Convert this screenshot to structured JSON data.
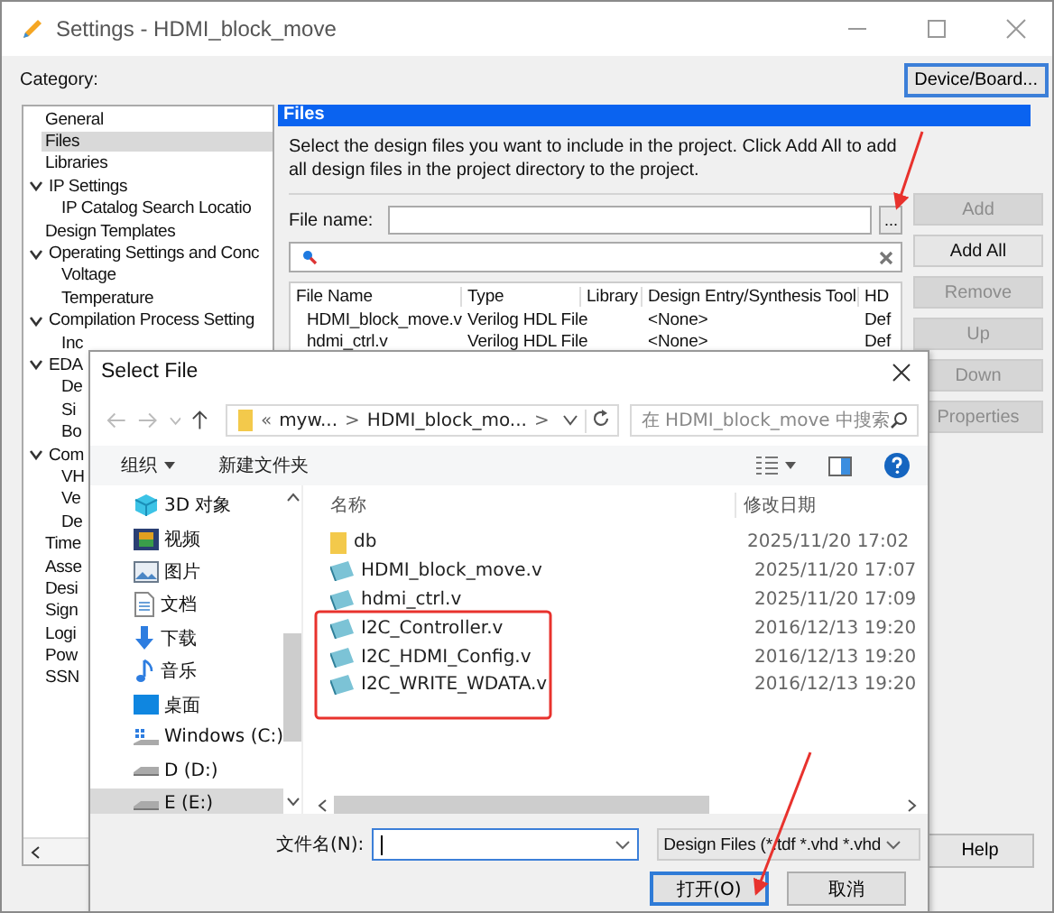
{
  "window": {
    "title": "Settings - HDMI_block_move"
  },
  "category_label": "Category:",
  "device_board_button": "Device/Board...",
  "category_tree": [
    {
      "label": "General",
      "selected": false
    },
    {
      "label": "Files",
      "selected": true
    },
    {
      "label": "Libraries",
      "selected": false
    },
    {
      "label": "IP Settings",
      "selected": false,
      "expanded": true,
      "children": [
        {
          "label": "IP Catalog Search Locatio",
          "selected": false
        }
      ]
    },
    {
      "label": "Design Templates",
      "selected": false
    },
    {
      "label": "Operating Settings and Conc",
      "selected": false,
      "expanded": true,
      "children": [
        {
          "label": "Voltage",
          "selected": false
        },
        {
          "label": "Temperature",
          "selected": false
        }
      ]
    },
    {
      "label": "Compilation Process Setting",
      "selected": false,
      "expanded": true,
      "children": [
        {
          "label": "Inc",
          "selected": false
        }
      ]
    },
    {
      "label": "EDA",
      "selected": false,
      "expanded": true,
      "children": [
        {
          "label": "De",
          "selected": false
        },
        {
          "label": "Si",
          "selected": false
        },
        {
          "label": "Bo",
          "selected": false
        }
      ]
    },
    {
      "label": "Com",
      "selected": false,
      "expanded": true,
      "children": [
        {
          "label": "VH",
          "selected": false
        },
        {
          "label": "Ve",
          "selected": false
        },
        {
          "label": "De",
          "selected": false
        }
      ]
    },
    {
      "label": "Time",
      "selected": false
    },
    {
      "label": "Asse",
      "selected": false
    },
    {
      "label": "Desi",
      "selected": false
    },
    {
      "label": "Sign",
      "selected": false
    },
    {
      "label": "Logi",
      "selected": false
    },
    {
      "label": "Pow",
      "selected": false
    },
    {
      "label": "SSN",
      "selected": false
    }
  ],
  "files_panel": {
    "title": "Files",
    "description": "Select the design files you want to include in the project. Click Add All to add all design files in the project directory to the project.",
    "file_name_label": "File name:",
    "browse_button": "...",
    "buttons": [
      {
        "label": "Add",
        "disabled": true
      },
      {
        "label": "Add All",
        "disabled": false
      },
      {
        "label": "Remove",
        "disabled": true
      },
      {
        "label": "Up",
        "disabled": true
      },
      {
        "label": "Down",
        "disabled": true
      },
      {
        "label": "Properties",
        "disabled": true
      }
    ],
    "table": {
      "columns": [
        "File Name",
        "Type",
        "Library",
        "Design Entry/Synthesis Tool",
        "HD"
      ],
      "rows": [
        {
          "file_name": "HDMI_block_move.v",
          "type": "Verilog HDL File",
          "design_entry": "<None>",
          "column_5": "Def"
        },
        {
          "file_name": "hdmi_ctrl.v",
          "type": "Verilog HDL File",
          "design_entry": "<None>",
          "column_5": "Def"
        }
      ]
    }
  },
  "help_button": "Help",
  "dialog": {
    "title": "Select File",
    "breadcrumb": [
      "«",
      "myw...",
      ">",
      "HDMI_block_mo...",
      ">"
    ],
    "search": {
      "placeholder": "在 HDMI_block_move 中搜索"
    },
    "toolbar": {
      "organize": "组织",
      "new_folder": "新建文件夹"
    },
    "nav_items": [
      {
        "label": "3D 对象",
        "kind": "cube",
        "selected": false
      },
      {
        "label": "视频",
        "kind": "video",
        "selected": false
      },
      {
        "label": "图片",
        "kind": "picture",
        "selected": false
      },
      {
        "label": "文档",
        "kind": "document",
        "selected": false
      },
      {
        "label": "下载",
        "kind": "download",
        "selected": false
      },
      {
        "label": "音乐",
        "kind": "music",
        "selected": false
      },
      {
        "label": "桌面",
        "kind": "desktop",
        "selected": false
      },
      {
        "label": "Windows (C:)",
        "kind": "system_drive",
        "selected": false
      },
      {
        "label": "D (D:)",
        "kind": "drive",
        "selected": false
      },
      {
        "label": "E (E:)",
        "kind": "drive",
        "selected": true
      }
    ],
    "columns": [
      "名称",
      "修改日期"
    ],
    "files": [
      {
        "name": "db",
        "date": "2025/11/20 17:02",
        "kind": "folder"
      },
      {
        "name": "HDMI_block_move.v",
        "date": "2025/11/20 17:07",
        "kind": "file"
      },
      {
        "name": "hdmi_ctrl.v",
        "date": "2025/11/20 17:09",
        "kind": "file"
      },
      {
        "name": "I2C_Controller.v",
        "date": "2016/12/13 19:20",
        "kind": "file"
      },
      {
        "name": "I2C_HDMI_Config.v",
        "date": "2016/12/13 19:20",
        "kind": "file"
      },
      {
        "name": "I2C_WRITE_WDATA.v",
        "date": "2016/12/13 19:20",
        "kind": "file"
      }
    ],
    "file_name_label": "文件名(N):",
    "file_type": "Design Files (*.tdf *.vhd *.vhd",
    "open_button": "打开(O)",
    "cancel_button": "取消"
  }
}
